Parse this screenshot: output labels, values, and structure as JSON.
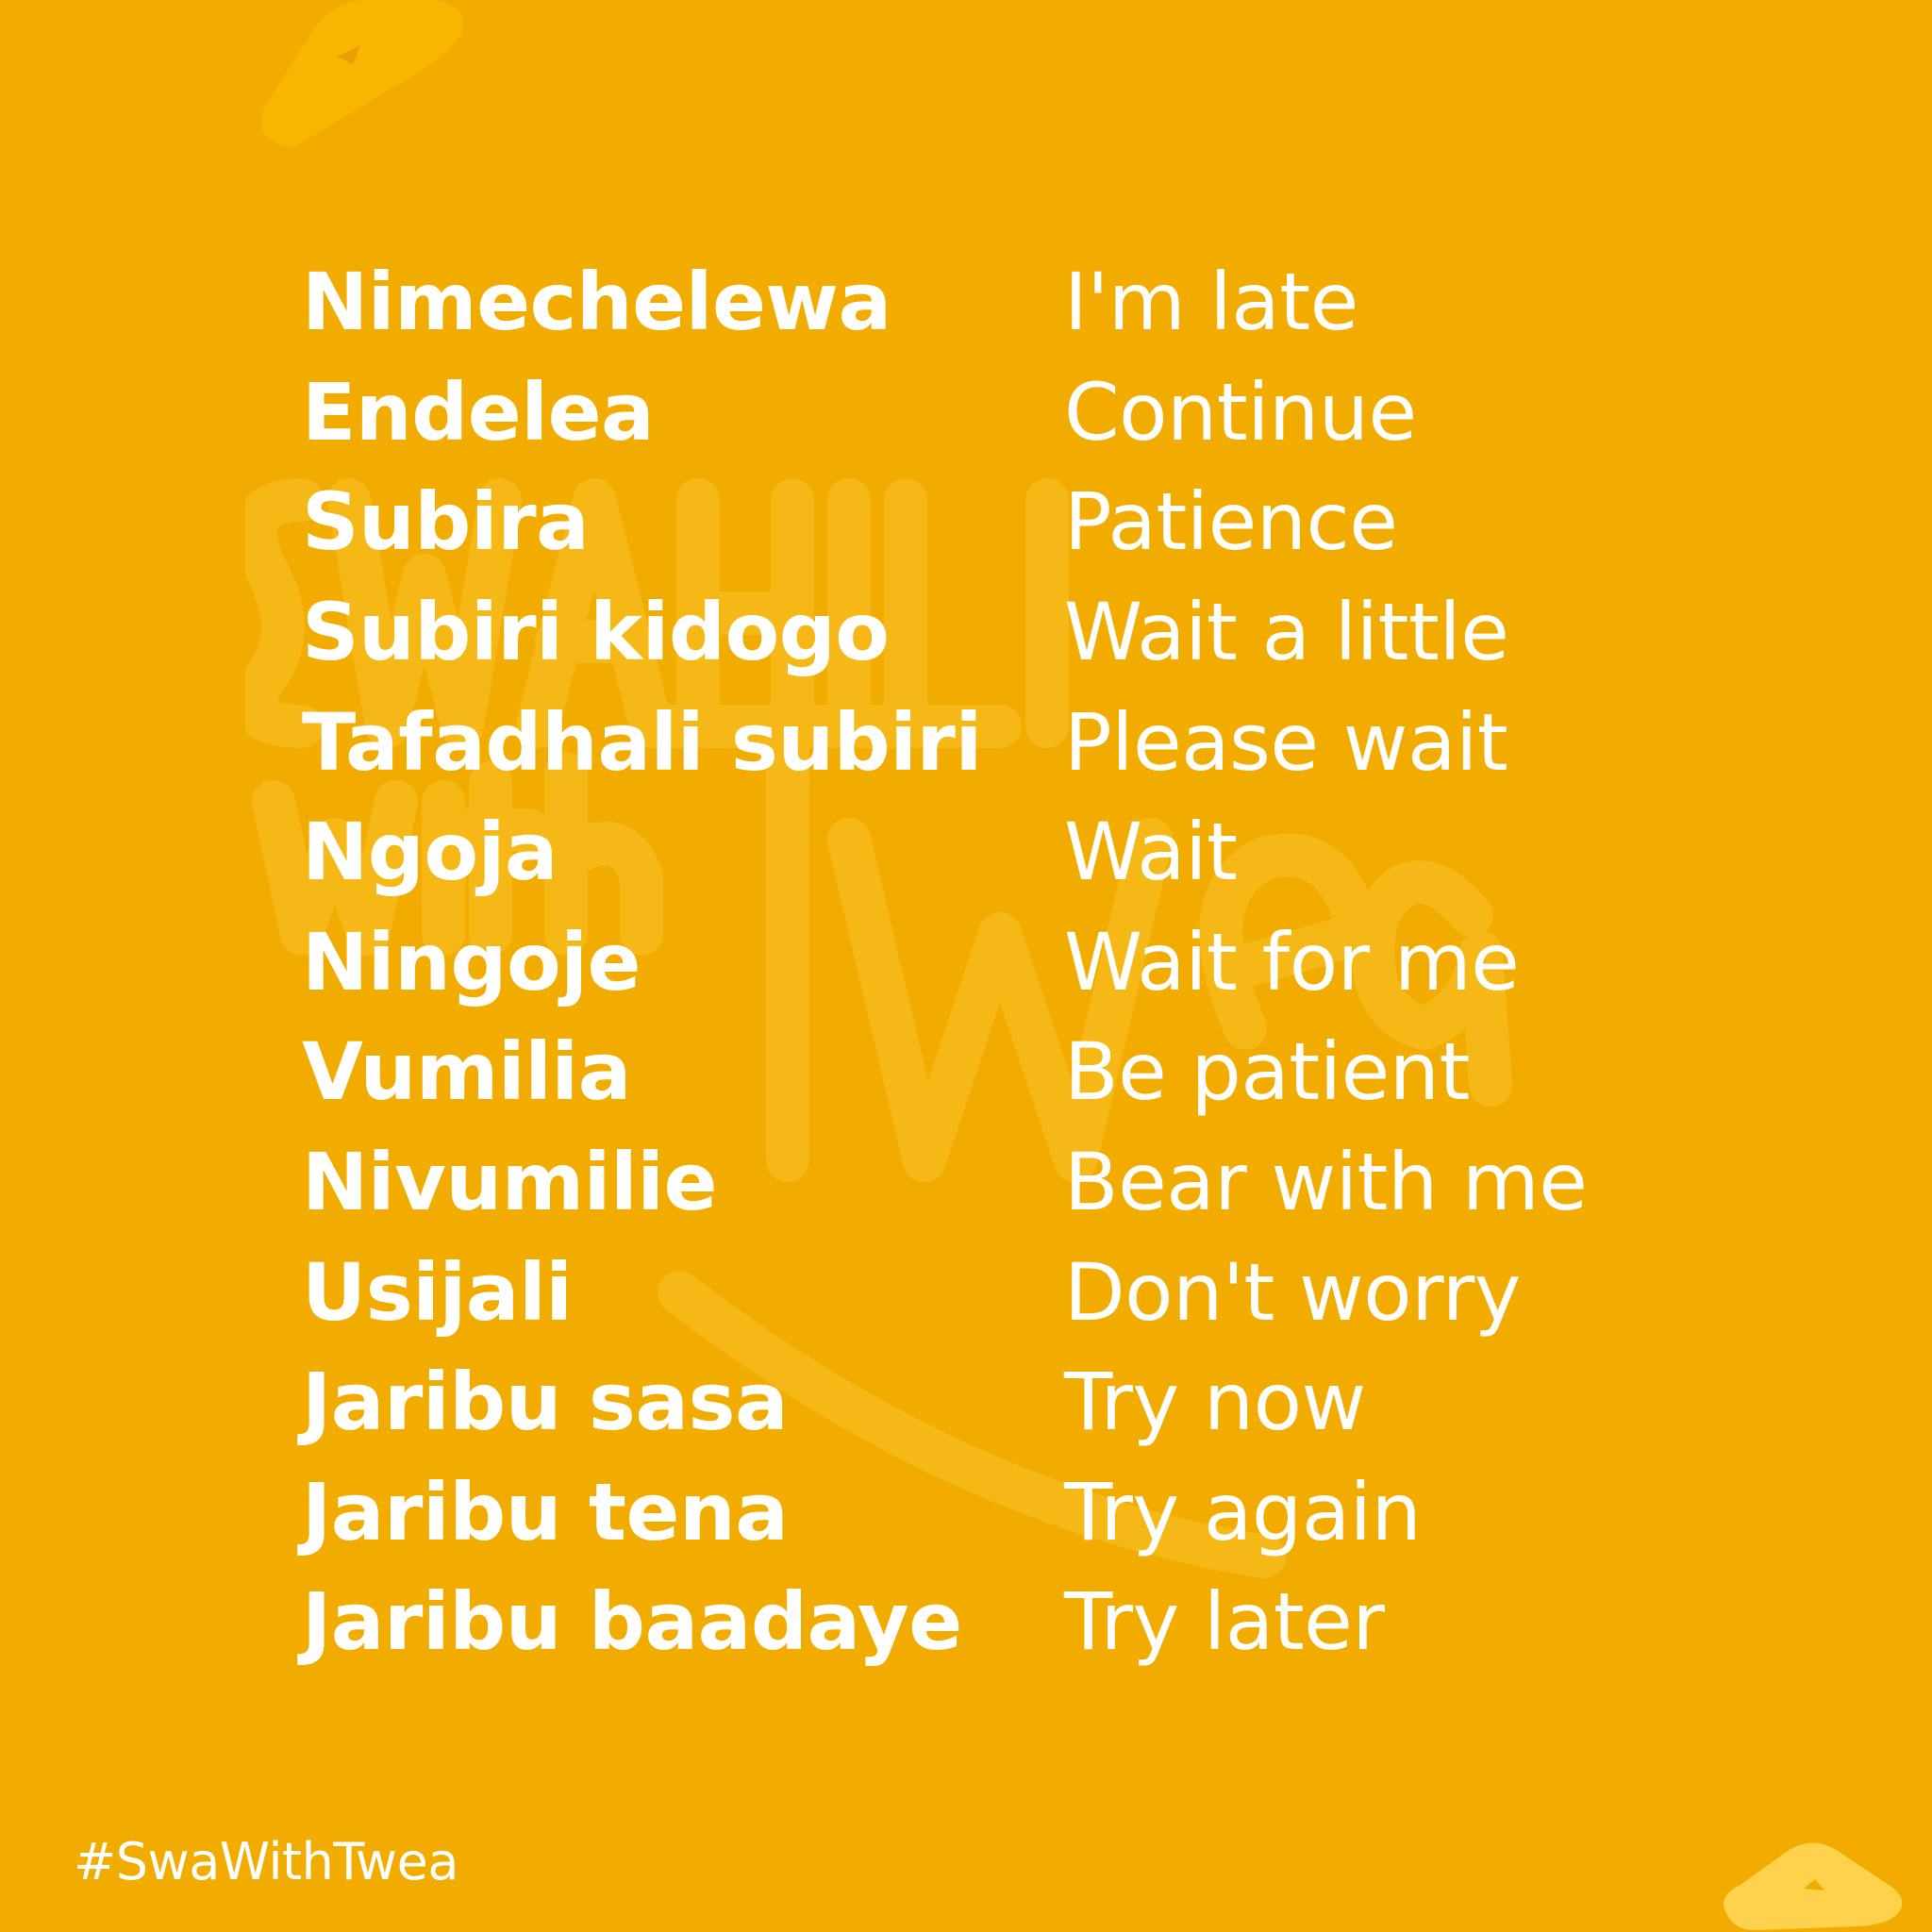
{
  "colors": {
    "background": "#F2AC00",
    "text": "#FFFFFF",
    "watermark": "#F5B816",
    "corner_shape_top": "#F8B600",
    "corner_shape_bottom": "#FFD24D"
  },
  "vocabulary": [
    {
      "swahili": "Nimechelewa",
      "english": "I'm late"
    },
    {
      "swahili": "Endelea",
      "english": "Continue"
    },
    {
      "swahili": "Subira",
      "english": "Patience"
    },
    {
      "swahili": "Subiri kidogo",
      "english": "Wait a little"
    },
    {
      "swahili": "Tafadhali subiri",
      "english": "Please wait"
    },
    {
      "swahili": "Ngoja",
      "english": "Wait"
    },
    {
      "swahili": "Ningoje",
      "english": "Wait for me"
    },
    {
      "swahili": "Vumilia",
      "english": "Be patient"
    },
    {
      "swahili": "Nivumilie",
      "english": "Bear with me"
    },
    {
      "swahili": "Usijali",
      "english": "Don't worry"
    },
    {
      "swahili": "Jaribu sasa",
      "english": "Try now"
    },
    {
      "swahili": "Jaribu tena",
      "english": "Try again"
    },
    {
      "swahili": "Jaribu baadaye",
      "english": "Try later"
    }
  ],
  "hashtag": "#SwaWithTwea",
  "watermark_icon": "swahili-with-twea-logo-watermark"
}
